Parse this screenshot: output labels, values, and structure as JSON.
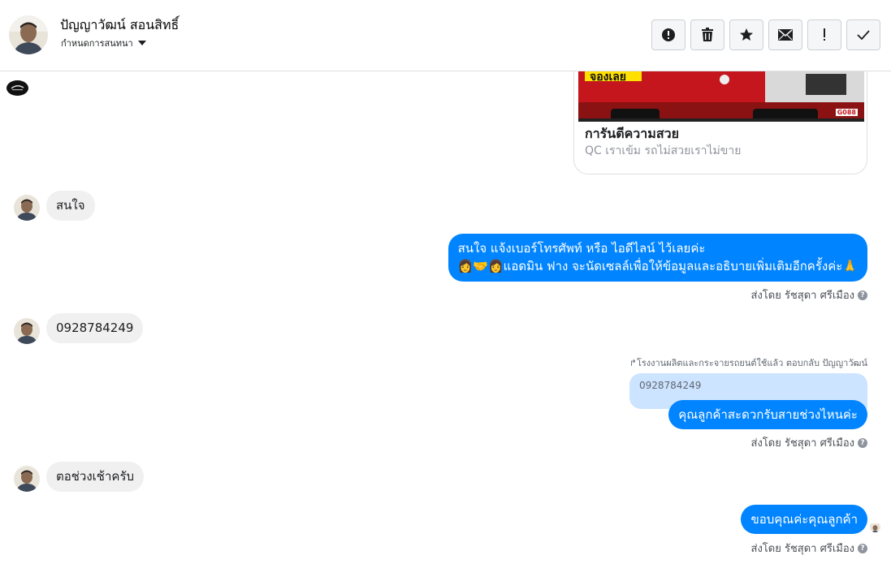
{
  "header": {
    "name": "ปัญญาวัฒน์ สอนสิทธิ์",
    "subtitle": "กำหนดการสนทนา",
    "toolbar": [
      {
        "name": "report-button",
        "icon": "alert-circle-icon"
      },
      {
        "name": "delete-button",
        "icon": "trash-icon"
      },
      {
        "name": "star-button",
        "icon": "star-icon"
      },
      {
        "name": "mark-unread-button",
        "icon": "envelope-icon"
      },
      {
        "name": "priority-button",
        "icon": "exclamation-icon"
      },
      {
        "name": "done-button",
        "icon": "checkmark-icon"
      }
    ]
  },
  "thread": {
    "card": {
      "image_text": "จองเลย",
      "image_code": "G088",
      "title": "การันตีความสวย",
      "subtitle": "QC เราเข้ม รถไม่สวยเราไม่ขาย"
    },
    "messages": [
      {
        "direction": "in",
        "text": "สนใจ"
      },
      {
        "direction": "out",
        "lines": [
          "สนใจ แจ้งเบอร์โทรศัพท์ หรือ ไอดีไลน์  ไว้เลยค่ะ",
          "👩‍🤝‍👩แอดมิน ฟาง จะนัดเซลล์เพื่อให้ข้อมูลและอธิบายเพิ่มเติมอีกครั้งค่ะ🙏"
        ],
        "sent_by": "ส่งโดย รัชสุดา ศรีเมือง"
      },
      {
        "direction": "in",
        "text": "0928784249"
      },
      {
        "direction": "out",
        "reply_note": "↱โรงงานผลิตและกระจายรถยนต์ใช้แล้ว ตอบกลับ ปัญญาวัฒน์",
        "quoted": "0928784249",
        "text": "คุณลูกค้าสะดวกรับสายช่วงไหนค่ะ",
        "sent_by": "ส่งโดย รัชสุดา ศรีเมือง"
      },
      {
        "direction": "in",
        "text": "ตอช่วงเช้าครับ"
      },
      {
        "direction": "out",
        "text": "ขอบคุณค่ะคุณลูกค้า",
        "sent_by": "ส่งโดย รัชสุดา ศรีเมือง"
      }
    ],
    "help_glyph": "?"
  },
  "colors": {
    "accent": "#0084ff",
    "incoming_bubble": "#f1f0f0",
    "quoted_bubble": "#cce4ff"
  }
}
